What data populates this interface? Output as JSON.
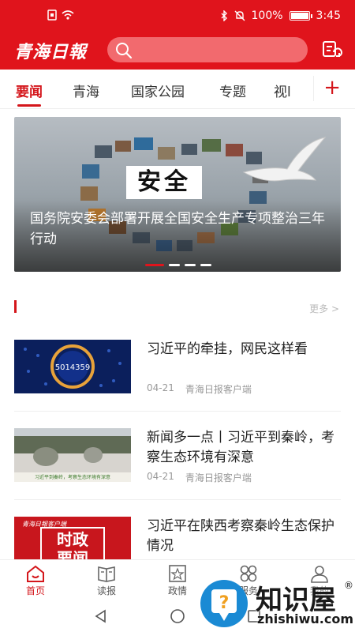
{
  "status": {
    "battery": "100%",
    "time": "3:45"
  },
  "app": {
    "logo_text": "青海日報",
    "search_placeholder": ""
  },
  "tabs": [
    {
      "label": "要闻",
      "active": true
    },
    {
      "label": "青海"
    },
    {
      "label": "国家公园"
    },
    {
      "label": "专题"
    },
    {
      "label": "视l"
    }
  ],
  "tab_plus": "+",
  "banner": {
    "image_text": "安全",
    "title": "国务院安委会部署开展全国安全生产专项整治三年行动",
    "slide_count": 4,
    "active_slide": 1
  },
  "section": {
    "more_label": "更多 >"
  },
  "news": [
    {
      "headline": "习近平的牵挂，网民这样看",
      "date": "04-21",
      "source": "青海日报客户端",
      "thumb_text": "5014359"
    },
    {
      "headline": "新闻多一点丨习近平到秦岭，考察生态环境有深意",
      "date": "04-21",
      "source": "青海日报客户端",
      "thumb_text": "习近平到秦岭，考察生态环境有深意"
    },
    {
      "headline": "习近平在陕西考察秦岭生态保护情况",
      "date": "",
      "source": "",
      "thumb_text": "时政要闻",
      "thumb_brand": "青海日報客户端"
    }
  ],
  "bottom_nav": [
    {
      "label": "首页",
      "active": true,
      "icon": "home-icon"
    },
    {
      "label": "读报",
      "icon": "newspaper-icon"
    },
    {
      "label": "政情",
      "icon": "politics-icon"
    },
    {
      "label": "服务",
      "icon": "services-icon"
    },
    {
      "label": "我的",
      "icon": "user-icon"
    }
  ],
  "watermark": {
    "brand": "知识屋",
    "registered": "®",
    "url": "zhishiwu.com"
  },
  "colors": {
    "brand_red": "#e0141c",
    "accent_red": "#d4161b"
  }
}
